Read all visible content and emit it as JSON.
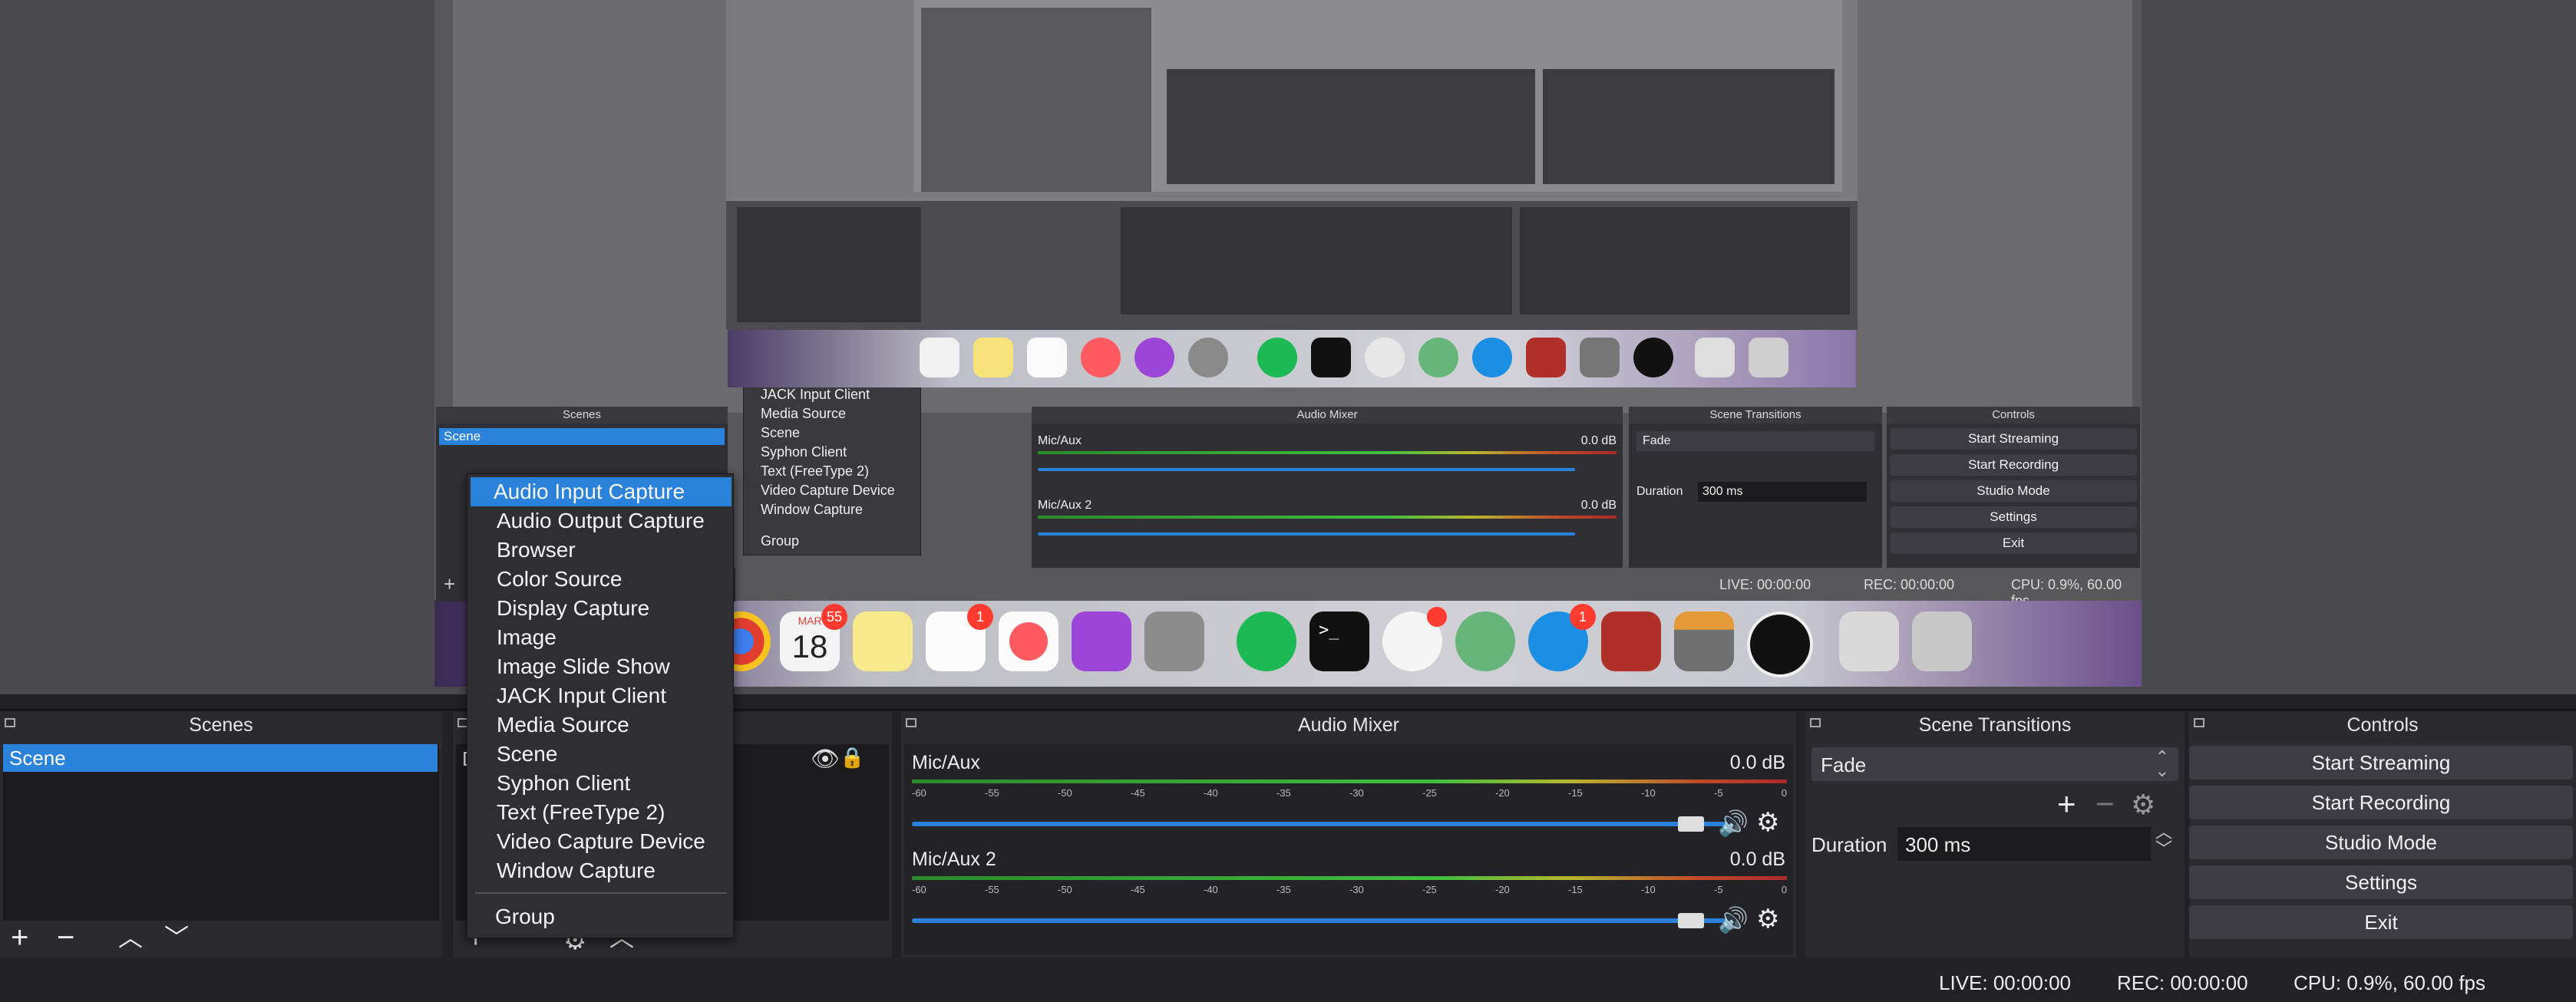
{
  "scenes": {
    "title": "Scenes",
    "items": [
      "Scene"
    ]
  },
  "sources": {
    "first_item_prefix": "D"
  },
  "audio_mixer": {
    "title": "Audio Mixer",
    "channels": [
      {
        "name": "Mic/Aux",
        "level": "0.0 dB",
        "volume": 0.94
      },
      {
        "name": "Mic/Aux 2",
        "level": "0.0 dB",
        "volume": 0.94
      }
    ],
    "scale": [
      "-60",
      "-55",
      "-50",
      "-45",
      "-40",
      "-35",
      "-30",
      "-25",
      "-20",
      "-15",
      "-10",
      "-5",
      "0"
    ]
  },
  "scene_transitions": {
    "title": "Scene Transitions",
    "transition": "Fade",
    "duration_label": "Duration",
    "duration_value": "300 ms"
  },
  "controls": {
    "title": "Controls",
    "start_streaming": "Start Streaming",
    "start_recording": "Start Recording",
    "studio_mode": "Studio Mode",
    "settings": "Settings",
    "exit": "Exit"
  },
  "status": {
    "live": "LIVE: 00:00:00",
    "rec": "REC: 00:00:00",
    "cpu": "CPU: 0.9%, 60.00 fps"
  },
  "context_menu": {
    "items": [
      "Audio Input Capture",
      "Audio Output Capture",
      "Browser",
      "Color Source",
      "Display Capture",
      "Image",
      "Image Slide Show",
      "JACK Input Client",
      "Media Source",
      "Scene",
      "Syphon Client",
      "Text (FreeType 2)",
      "Video Capture Device",
      "Window Capture"
    ],
    "group": "Group",
    "highlighted_index": 0
  },
  "dock_badges": {
    "calendar_month": "MAR",
    "calendar_day": "18",
    "calendar_badge": "55",
    "reminders_badge": "1",
    "slack_badge": "",
    "skype_badge": "1"
  },
  "colors": {
    "accent": "#2a82da",
    "panel": "#2b2b2f",
    "background": "#222226"
  }
}
